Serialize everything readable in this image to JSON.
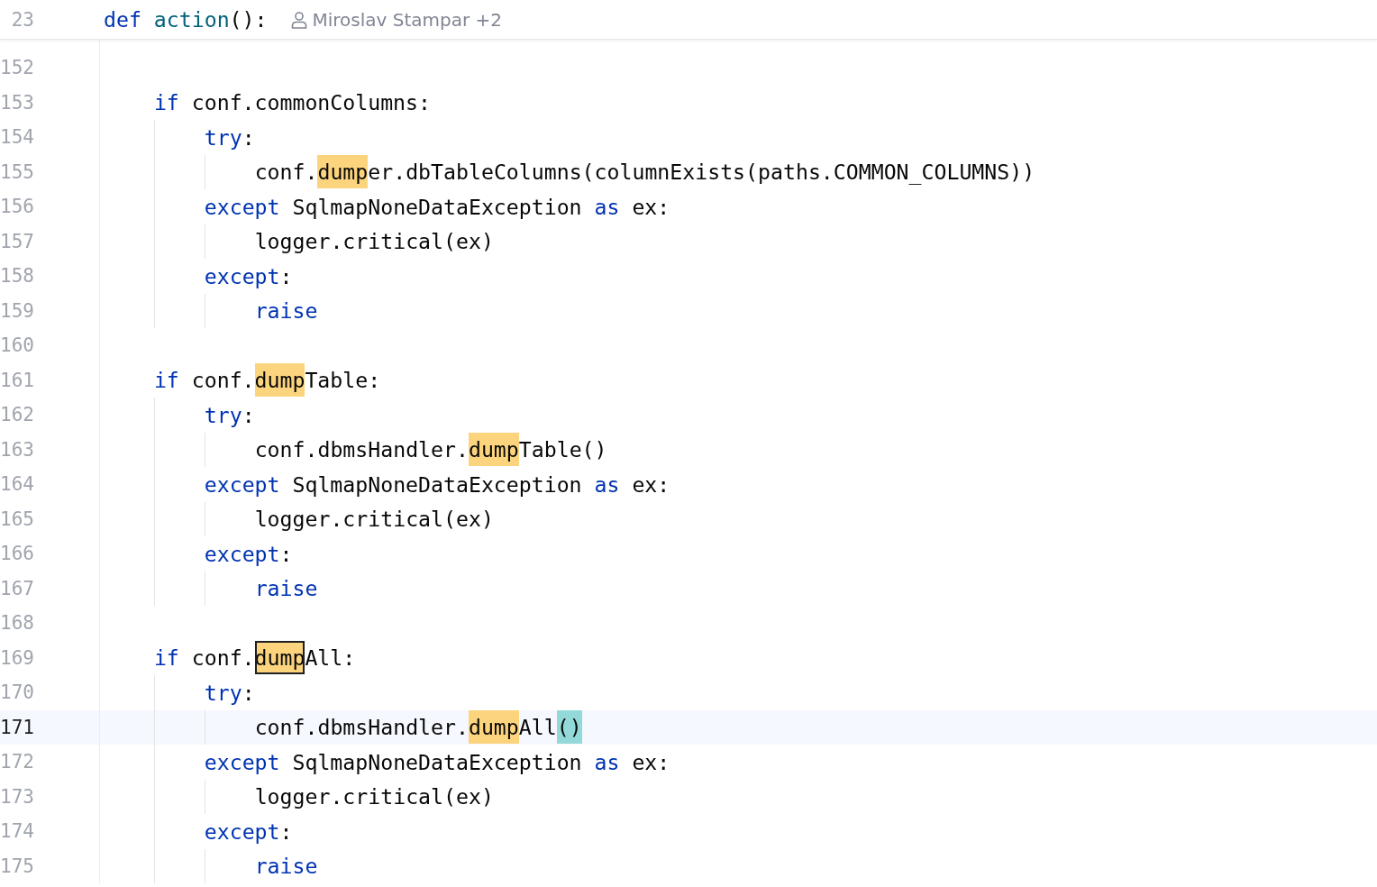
{
  "sticky_header": {
    "line_number": "23",
    "tokens": [
      {
        "text": "def ",
        "kind": "keyword"
      },
      {
        "text": "action",
        "kind": "function"
      },
      {
        "text": "():",
        "kind": "plain"
      }
    ],
    "author": "Miroslav Stampar +2"
  },
  "lines": [
    {
      "number": "152",
      "current": false
    },
    {
      "number": "153",
      "current": false,
      "tokens": [
        {
          "text": "if",
          "kind": "keyword"
        },
        {
          "text": " conf.commonColumns:",
          "kind": "plain"
        }
      ],
      "children": [
        {
          "number": "154",
          "current": false,
          "tokens": [
            {
              "text": "try",
              "kind": "keyword"
            },
            {
              "text": ":",
              "kind": "plain"
            }
          ],
          "children": [
            {
              "number": "155",
              "current": false,
              "tokens": [
                {
                  "text": "conf.",
                  "kind": "plain"
                },
                {
                  "text": "dump",
                  "kind": "match"
                },
                {
                  "text": "er.dbTableColumns(columnExists(paths.COMMON_COLUMNS))",
                  "kind": "plain"
                }
              ]
            }
          ]
        },
        {
          "number": "156",
          "current": false,
          "tokens": [
            {
              "text": "except",
              "kind": "keyword"
            },
            {
              "text": " SqlmapNoneDataException ",
              "kind": "plain"
            },
            {
              "text": "as",
              "kind": "keyword"
            },
            {
              "text": " ex:",
              "kind": "plain"
            }
          ],
          "children": [
            {
              "number": "157",
              "current": false,
              "tokens": [
                {
                  "text": "logger.critical(ex)",
                  "kind": "plain"
                }
              ]
            }
          ]
        },
        {
          "number": "158",
          "current": false,
          "tokens": [
            {
              "text": "except",
              "kind": "keyword"
            },
            {
              "text": ":",
              "kind": "plain"
            }
          ],
          "children": [
            {
              "number": "159",
              "current": false,
              "tokens": [
                {
                  "text": "raise",
                  "kind": "keyword"
                }
              ]
            }
          ]
        }
      ]
    },
    {
      "number": "160",
      "current": false
    },
    {
      "number": "161",
      "current": false,
      "tokens": [
        {
          "text": "if",
          "kind": "keyword"
        },
        {
          "text": " conf.",
          "kind": "plain"
        },
        {
          "text": "dump",
          "kind": "match"
        },
        {
          "text": "Table:",
          "kind": "plain"
        }
      ],
      "children": [
        {
          "number": "162",
          "current": false,
          "tokens": [
            {
              "text": "try",
              "kind": "keyword"
            },
            {
              "text": ":",
              "kind": "plain"
            }
          ],
          "children": [
            {
              "number": "163",
              "current": false,
              "tokens": [
                {
                  "text": "conf.dbmsHandler.",
                  "kind": "plain"
                },
                {
                  "text": "dump",
                  "kind": "match"
                },
                {
                  "text": "Table()",
                  "kind": "plain"
                }
              ]
            }
          ]
        },
        {
          "number": "164",
          "current": false,
          "tokens": [
            {
              "text": "except",
              "kind": "keyword"
            },
            {
              "text": " SqlmapNoneDataException ",
              "kind": "plain"
            },
            {
              "text": "as",
              "kind": "keyword"
            },
            {
              "text": " ex:",
              "kind": "plain"
            }
          ],
          "children": [
            {
              "number": "165",
              "current": false,
              "tokens": [
                {
                  "text": "logger.critical(ex)",
                  "kind": "plain"
                }
              ]
            }
          ]
        },
        {
          "number": "166",
          "current": false,
          "tokens": [
            {
              "text": "except",
              "kind": "keyword"
            },
            {
              "text": ":",
              "kind": "plain"
            }
          ],
          "children": [
            {
              "number": "167",
              "current": false,
              "tokens": [
                {
                  "text": "raise",
                  "kind": "keyword"
                }
              ]
            }
          ]
        }
      ]
    },
    {
      "number": "168",
      "current": false
    },
    {
      "number": "169",
      "current": false,
      "tokens": [
        {
          "text": "if",
          "kind": "keyword"
        },
        {
          "text": " conf.",
          "kind": "plain"
        },
        {
          "text": "dump",
          "kind": "match_current"
        },
        {
          "text": "All:",
          "kind": "plain"
        }
      ],
      "children": [
        {
          "number": "170",
          "current": false,
          "tokens": [
            {
              "text": "try",
              "kind": "keyword"
            },
            {
              "text": ":",
              "kind": "plain"
            }
          ],
          "children": [
            {
              "number": "171",
              "current": true,
              "tokens": [
                {
                  "text": "conf.dbmsHandler.",
                  "kind": "plain"
                },
                {
                  "text": "dump",
                  "kind": "match"
                },
                {
                  "text": "All",
                  "kind": "plain"
                },
                {
                  "text": "()",
                  "kind": "bracket"
                }
              ]
            }
          ]
        },
        {
          "number": "172",
          "current": false,
          "tokens": [
            {
              "text": "except",
              "kind": "keyword"
            },
            {
              "text": " SqlmapNoneDataException ",
              "kind": "plain"
            },
            {
              "text": "as",
              "kind": "keyword"
            },
            {
              "text": " ex:",
              "kind": "plain"
            }
          ],
          "children": [
            {
              "number": "173",
              "current": false,
              "tokens": [
                {
                  "text": "logger.critical(ex)",
                  "kind": "plain"
                }
              ]
            }
          ]
        },
        {
          "number": "174",
          "current": false,
          "tokens": [
            {
              "text": "except",
              "kind": "keyword"
            },
            {
              "text": ":",
              "kind": "plain"
            }
          ],
          "children": [
            {
              "number": "175",
              "current": false,
              "tokens": [
                {
                  "text": "raise",
                  "kind": "keyword"
                }
              ]
            }
          ]
        }
      ]
    }
  ]
}
